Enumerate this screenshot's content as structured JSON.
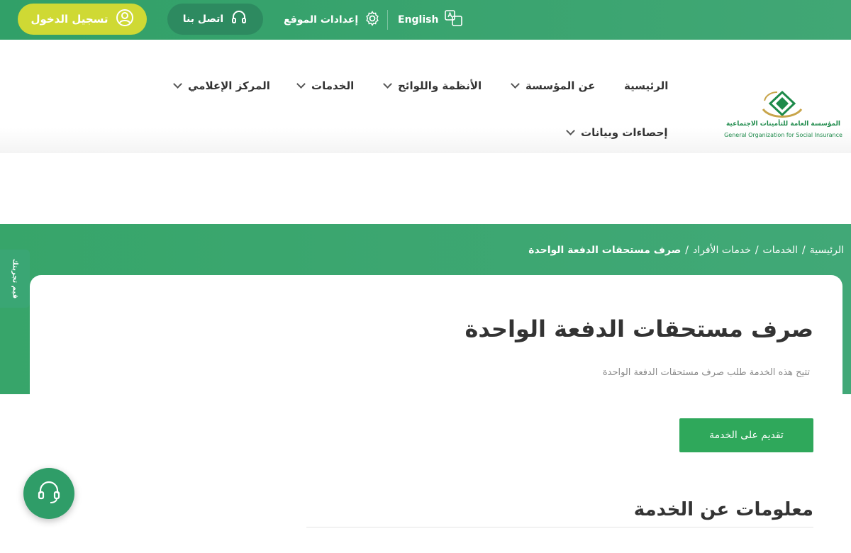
{
  "topbar": {
    "login_label": "تسجيل الدخول",
    "contact_label": "اتصل بنا",
    "settings_label": "إعدادات الموقع",
    "language_label": "English"
  },
  "logo": {
    "arabic_name": "المؤسسة العامة للتأمينات الاجتماعية",
    "english_name": "General Organization for Social Insurance"
  },
  "nav": {
    "home": "الرئيسية",
    "about": "عن المؤسسة",
    "regulations": "الأنظمة واللوائح",
    "services": "الخدمات",
    "media": "المركز الإعلامي",
    "stats": "إحصاءات وبيانات"
  },
  "breadcrumb": {
    "home": "الرئيسية",
    "services": "الخدمات",
    "individuals": "خدمات الأفراد",
    "current": "صرف مستحقات الدفعة الواحدة",
    "sep": "/"
  },
  "page": {
    "title": "صرف مستحقات الدفعة الواحدة",
    "description": "تتيح هذه الخدمة طلب صرف مستحقات الدفعة الواحدة",
    "apply_label": "تقديم على الخدمة",
    "info_title": "معلومات عن الخدمة"
  },
  "side": {
    "feedback_label": "قيم تجربتك"
  },
  "icons": {
    "login": "user-circle-icon",
    "contact": "headset-icon",
    "settings": "gear-icon",
    "language": "translate-icon",
    "support": "headset-icon"
  },
  "colors": {
    "primary_green": "#3aa56d",
    "login_yellow": "#cfd934",
    "apply_green": "#2fa85b"
  }
}
